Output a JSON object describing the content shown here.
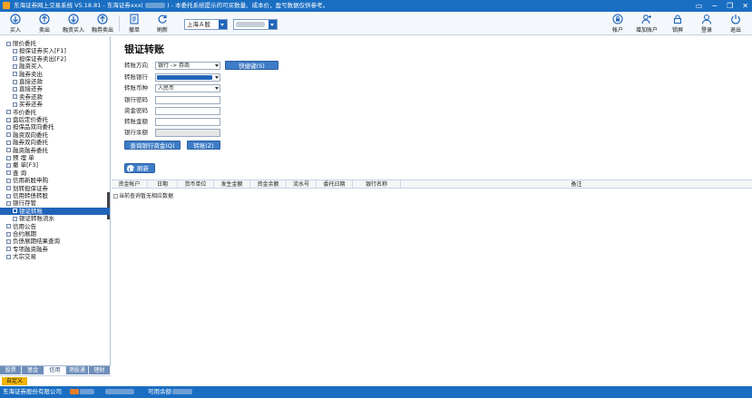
{
  "window": {
    "title": "东海证券网上交易系统 V5.18.81 - 东海证券xxx(",
    "title_suffix": ") - 本委托系统提示的可买数量、成本价，盈亏数据仅供参考。",
    "controls": [
      "▭",
      "−",
      "❐",
      "✕"
    ]
  },
  "toolbar": {
    "left_buttons": [
      {
        "label": "买入",
        "icon": "buy-icon"
      },
      {
        "label": "卖出",
        "icon": "sell-icon"
      },
      {
        "label": "融资买入",
        "icon": "margin-buy-icon"
      },
      {
        "label": "融券卖出",
        "icon": "short-sell-icon"
      },
      {
        "label": "撤单",
        "icon": "cancel-order-icon"
      },
      {
        "label": "刷新",
        "icon": "refresh-icon"
      }
    ],
    "market_select": "上海Ａ股",
    "right_buttons": [
      {
        "label": "帐户",
        "icon": "lock-icon"
      },
      {
        "label": "增加账户",
        "icon": "add-account-icon"
      },
      {
        "label": "锁屏",
        "icon": "lock-screen-icon"
      },
      {
        "label": "登录",
        "icon": "user-icon"
      },
      {
        "label": "退出",
        "icon": "power-icon"
      }
    ]
  },
  "sidebar": {
    "items": [
      {
        "label": "限价委托",
        "indent": 0
      },
      {
        "label": "担保证券买入[F1]",
        "indent": 1
      },
      {
        "label": "担保证券卖出[F2]",
        "indent": 1
      },
      {
        "label": "融资买入",
        "indent": 1
      },
      {
        "label": "融券卖出",
        "indent": 1
      },
      {
        "label": "直接还款",
        "indent": 1
      },
      {
        "label": "直接还券",
        "indent": 1
      },
      {
        "label": "卖券还款",
        "indent": 1
      },
      {
        "label": "买券还券",
        "indent": 1
      },
      {
        "label": "市价委托",
        "indent": 0
      },
      {
        "label": "盘后定价委托",
        "indent": 0
      },
      {
        "label": "担保品双向委托",
        "indent": 0
      },
      {
        "label": "融资双向委托",
        "indent": 0
      },
      {
        "label": "融券双向委托",
        "indent": 0
      },
      {
        "label": "融资融券委托",
        "indent": 0
      },
      {
        "label": "预 埋 单",
        "indent": 0
      },
      {
        "label": "撤      单[F3]",
        "indent": 0
      },
      {
        "label": "查      询",
        "indent": 0
      },
      {
        "label": "信用新股申购",
        "indent": 0
      },
      {
        "label": "划转担保证券",
        "indent": 0
      },
      {
        "label": "信用转债转股",
        "indent": 0
      },
      {
        "label": "银行存管",
        "indent": 0
      },
      {
        "label": "银证转账",
        "indent": 1,
        "selected": true
      },
      {
        "label": "银证转账流水",
        "indent": 1
      },
      {
        "label": "信用公告",
        "indent": 0
      },
      {
        "label": "合约展期",
        "indent": 0
      },
      {
        "label": "负债展期结果查询",
        "indent": 0
      },
      {
        "label": "专项融资融券",
        "indent": 0
      },
      {
        "label": "大宗交易",
        "indent": 0
      }
    ],
    "tabs": [
      "股票",
      "基金",
      "信用",
      "港股通",
      "理财"
    ],
    "active_tab": "信用",
    "custom_button": "自定义"
  },
  "main": {
    "title": "银证转账",
    "labels": {
      "direction": "转账方向",
      "bank": "转账银行",
      "currency": "转账币种",
      "bank_password": "银行密码",
      "fund_password": "资金密码",
      "amount": "转账金额",
      "bank_balance": "银行余额"
    },
    "direction_value": "银行 -> 券商",
    "currency_value": "人民币",
    "quick_key_button": "快捷键(S)",
    "query_bank_balance_button": "查询银行资金(Q)",
    "transfer_button": "转账(Z)",
    "refresh_button": "刷新",
    "grid_columns": [
      "资金帐户",
      "日期",
      "货币单位",
      "发生金额",
      "资金余额",
      "流水号",
      "委托日期",
      "银行名称",
      "备注"
    ],
    "empty_message": "当前查询暂无相应数据"
  },
  "statusbar": {
    "company": "东海证券股份有限公司",
    "available_funds_label": "可用余额"
  },
  "colors": {
    "titlebar": "#1a6ec2",
    "accent": "#1f64b9",
    "button": "#3e7cc7",
    "custom_button": "#f0b400"
  }
}
